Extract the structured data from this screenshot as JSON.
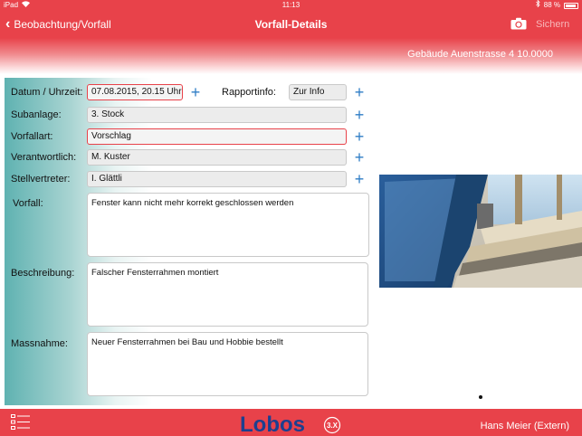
{
  "status_bar": {
    "carrier": "iPad",
    "time": "11:13",
    "battery": "88 %"
  },
  "nav": {
    "back_label": "Beobachtung/Vorfall",
    "title": "Vorfall-Details",
    "save_label": "Sichern",
    "camera_icon": "camera-icon"
  },
  "building": "Gebäude Auenstrasse 4  10.0000",
  "form": {
    "datum_label": "Datum / Uhrzeit:",
    "datum_value": "07.08.2015, 20.15 Uhr",
    "rapport_label": "Rapportinfo:",
    "rapport_value": "Zur Info",
    "subanlage_label": "Subanlage:",
    "subanlage_value": "3. Stock",
    "vorfallart_label": "Vorfallart:",
    "vorfallart_value": "Vorschlag",
    "verantwortlich_label": "Verantwortlich:",
    "verantwortlich_value": "M. Kuster",
    "stellvertreter_label": "Stellvertreter:",
    "stellvertreter_value": "I. Glättli",
    "vorfall_label": "Vorfall:",
    "vorfall_value": "Fenster kann nicht mehr korrekt geschlossen werden",
    "beschreibung_label": "Beschreibung:",
    "beschreibung_value": "Falscher Fensterrahmen montiert",
    "massnahme_label": "Massnahme:",
    "massnahme_value": "Neuer Fensterrahmen bei Bau und Hobbie bestellt"
  },
  "bottom_bar": {
    "logo_text": "Lobos",
    "logo_version": "3.X",
    "user": "Hans Meier (Extern)"
  },
  "colors": {
    "accent": "#e8424a",
    "plus": "#2f7ec6",
    "panel_teal": "#5fb2b1"
  }
}
